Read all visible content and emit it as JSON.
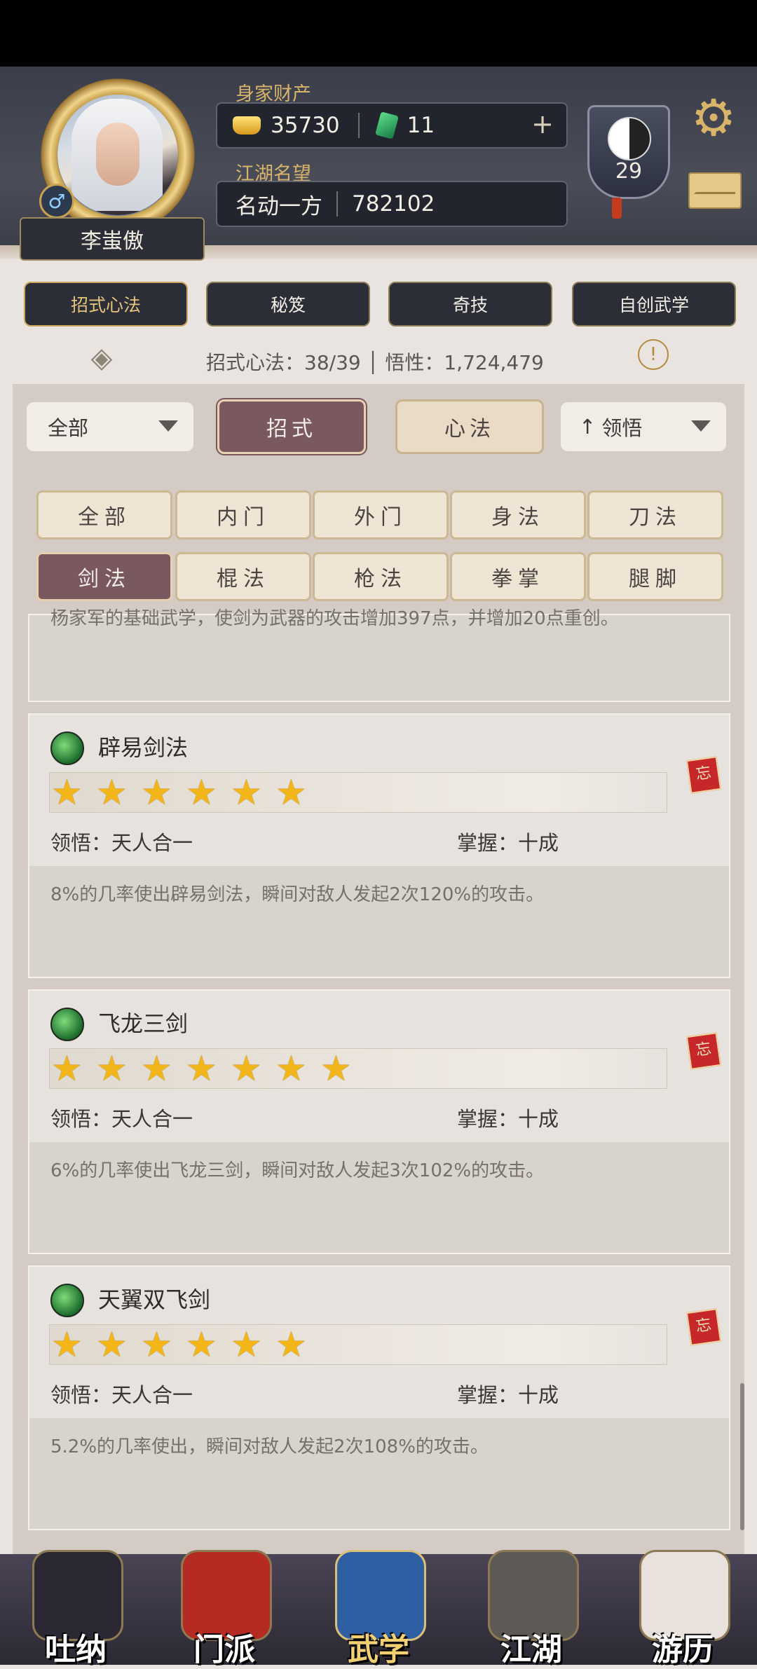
{
  "profile": {
    "name": "李蚩傲",
    "wealth_label": "身家财产",
    "gold": "35730",
    "jade": "11",
    "fame_label": "江湖名望",
    "fame_title": "名动一方",
    "fame_value": "782102",
    "level": "29",
    "gender_symbol": "♂"
  },
  "top_tabs": [
    "招式心法",
    "秘笈",
    "奇技",
    "自创武学"
  ],
  "stats_line": "招式心法：38/39 │ 悟性：1,724,479",
  "filters": {
    "type_dropdown": "全部",
    "seg_left": "招式",
    "seg_right": "心法",
    "sort_dropdown": "领悟",
    "sort_arrow": "↑"
  },
  "categories": [
    "全部",
    "内门",
    "外门",
    "身法",
    "刀法",
    "剑法",
    "棍法",
    "枪法",
    "拳掌",
    "腿脚"
  ],
  "partial_card_text": "杨家军的基础武学，使剑为武器的攻击增加397点，并增加20点重创。",
  "skills": [
    {
      "name": "辟易剑法",
      "stars": 6,
      "comprehend": "领悟：天人合一",
      "mastery": "掌握：十成",
      "desc": "8%的几率使出辟易剑法，瞬间对敌人发起2次120%的攻击。",
      "tag": "忘"
    },
    {
      "name": "飞龙三剑",
      "stars": 7,
      "comprehend": "领悟：天人合一",
      "mastery": "掌握：十成",
      "desc": "6%的几率使出飞龙三剑，瞬间对敌人发起3次102%的攻击。",
      "tag": "忘"
    },
    {
      "name": "天翼双飞剑",
      "stars": 6,
      "comprehend": "领悟：天人合一",
      "mastery": "掌握：十成",
      "desc": "5.2%的几率使出，瞬间对敌人发起2次108%的攻击。",
      "tag": "忘"
    }
  ],
  "bottom_nav": [
    {
      "label": "吐纳",
      "icon": "meditation-icon"
    },
    {
      "label": "门派",
      "icon": "sect-banner-icon"
    },
    {
      "label": "武学",
      "icon": "martial-book-icon",
      "active": true
    },
    {
      "label": "江湖",
      "icon": "bamboo-hat-icon"
    },
    {
      "label": "游历",
      "icon": "horse-icon"
    }
  ],
  "colors": {
    "accent_gold": "#d8b36a",
    "active_purple": "#7a5860",
    "star": "#f2b61b"
  }
}
